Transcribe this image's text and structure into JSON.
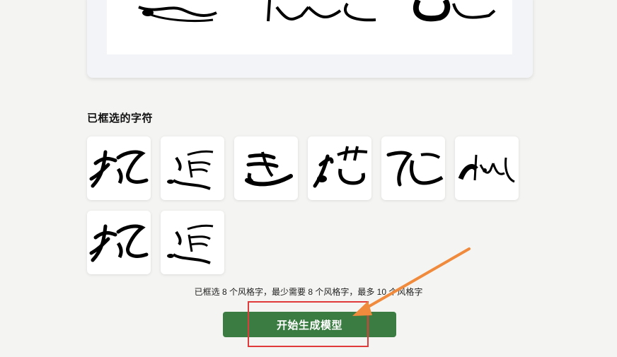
{
  "section_title": "已框选的字符",
  "status": {
    "text": "已框选 8 个风格字，最少需要 8 个风格字，最多 10 个风格字"
  },
  "actions": {
    "start_label": "开始生成模型"
  },
  "glyphs": [
    {
      "name": "glyph-1"
    },
    {
      "name": "glyph-2"
    },
    {
      "name": "glyph-3"
    },
    {
      "name": "glyph-4"
    },
    {
      "name": "glyph-5"
    },
    {
      "name": "glyph-6"
    },
    {
      "name": "glyph-7"
    },
    {
      "name": "glyph-8"
    }
  ],
  "colors": {
    "button": "#3a7c41",
    "highlight": "#e03a3a",
    "arrow": "#f08a3c"
  }
}
